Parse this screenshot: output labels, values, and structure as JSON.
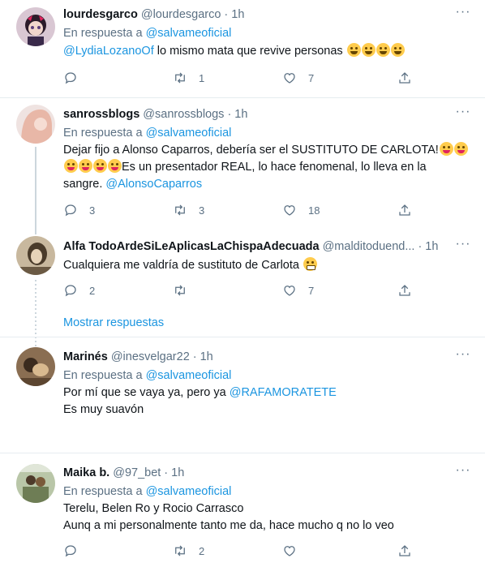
{
  "tweets": [
    {
      "name": "lourdesgarco",
      "handle": "@lourdesgarco",
      "time": "1h",
      "reply_prefix": "En respuesta a",
      "reply_to": "@salvameoficial",
      "mention": "@LydiaLozanoOf",
      "text": " lo mismo mata que revive personas ",
      "emojis": [
        "joy",
        "rofl",
        "joy",
        "rofl"
      ],
      "replies": "",
      "retweets": "1",
      "likes": "7"
    },
    {
      "name": "sanrossblogs",
      "handle": "@sanrossblogs",
      "time": "1h",
      "reply_prefix": "En respuesta a",
      "reply_to": "@salvameoficial",
      "text_line1": "Dejar fijo a Alonso Caparros, debería ser el SUSTITUTO DE CARLOTA!",
      "text_line2": "Es un presentador REAL, lo hace fenomenal, lo lleva en la",
      "text_line3": "sangre. ",
      "mention": "@AlonsoCaparros",
      "emojis": [
        "tongue-wink",
        "tongue-wink",
        "tongue-wink",
        "tongue-wink",
        "tongue-wink",
        "tongue-wink"
      ],
      "replies": "3",
      "retweets": "3",
      "likes": "18"
    },
    {
      "name": "Alfa TodoArdeSiLeAplicasLaChispaAdecuada",
      "handle": "@malditoduend...",
      "time": "1h",
      "text": "Cualquiera me valdría de sustituto de Carlota ",
      "emojis": [
        "grimace"
      ],
      "replies": "2",
      "retweets": "",
      "likes": "7"
    },
    {
      "show_replies": "Mostrar respuestas"
    },
    {
      "name": "Marinés",
      "handle": "@inesvelgar22",
      "time": "1h",
      "reply_prefix": "En respuesta a",
      "reply_to": "@salvameoficial",
      "text_line1": "Por mí que se vaya ya, pero ya ",
      "mention": "@RAFAMORATETE",
      "text_line2": "Es muy suavón"
    },
    {
      "name": "Maika b.",
      "handle": "@97_bet",
      "time": "1h",
      "reply_prefix": "En respuesta a",
      "reply_to": "@salvameoficial",
      "text_line1": "Terelu, Belen Ro y Rocio Carrasco",
      "text_line2": "Aunq a mi personalmente tanto me da, hace mucho q no lo veo",
      "replies": "",
      "retweets": "2",
      "likes": ""
    }
  ],
  "dot": "·",
  "icons": [
    "reply-icon",
    "retweet-icon",
    "like-icon",
    "share-icon",
    "more-icon"
  ],
  "colors": {
    "link": "#1b95e0",
    "muted": "#5b7083",
    "divider": "#e6ecf0",
    "thread": "#ccd6dd"
  }
}
